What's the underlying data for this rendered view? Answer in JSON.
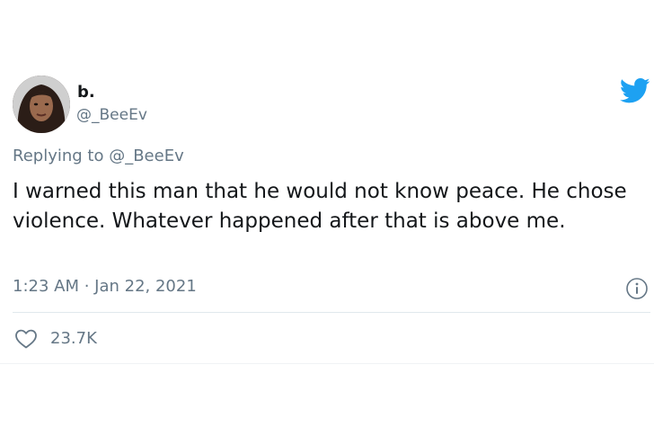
{
  "author": {
    "display_name": "b.",
    "handle": "@_BeeEv",
    "avatar_icon": "profile-photo"
  },
  "reply": {
    "text": "Replying to @_BeeEv"
  },
  "tweet": {
    "text": "I warned this man that he would not know peace. He chose violence. Whatever happened after that is above me.",
    "timestamp": "1:23 AM · Jan 22, 2021"
  },
  "stats": {
    "likes": "23.7K"
  },
  "icons": {
    "brand": "twitter-bird-icon",
    "info": "info-icon",
    "like": "heart-icon"
  },
  "colors": {
    "brand": "#1da1f2",
    "muted": "#657786",
    "text": "#14171a",
    "divider": "#e1e8ed"
  }
}
